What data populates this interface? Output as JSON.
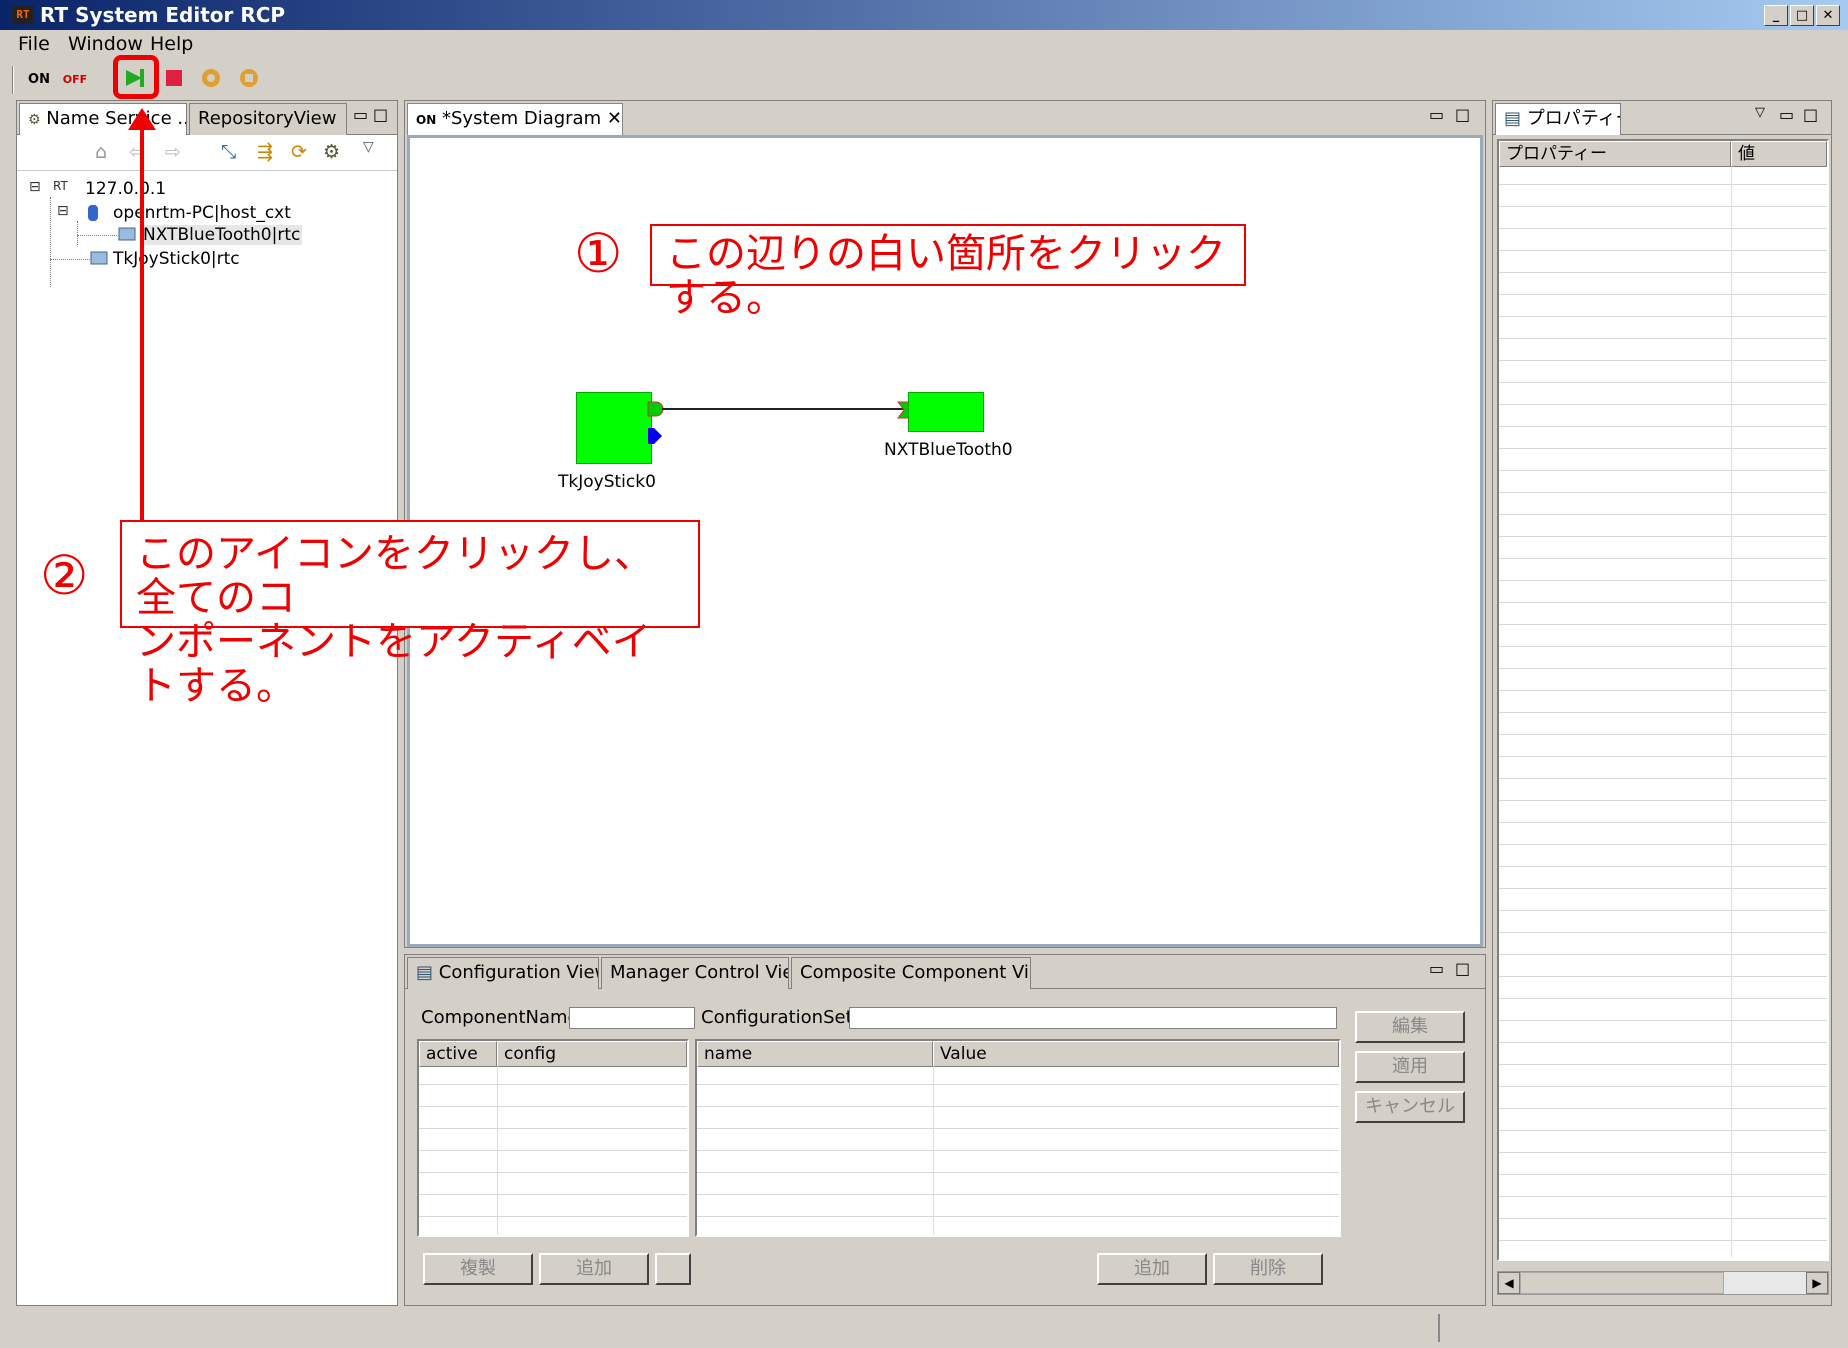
{
  "window": {
    "title": "RT System Editor RCP",
    "icon_text": "RT"
  },
  "menu": [
    "File",
    "Window",
    "Help"
  ],
  "toolbar": {
    "on_label": "ON",
    "off_label": "OFF",
    "icons": [
      "all-on-icon",
      "all-off-icon",
      "activate-all-icon",
      "deactivate-all-icon",
      "start-icon",
      "stop-icon"
    ]
  },
  "left_panel": {
    "tabs": [
      "Name Service ...",
      "RepositoryView"
    ],
    "tree": {
      "root": "127.0.0.1",
      "root_prefix": "RT",
      "host": "openrtm-PC|host_cxt",
      "children": [
        "NXTBlueTooth0|rtc",
        "TkJoyStick0|rtc"
      ]
    }
  },
  "diagram": {
    "tab_label": "*System Diagram",
    "components": [
      "TkJoyStick0",
      "NXTBlueTooth0"
    ],
    "colors": {
      "component": "#00ff00",
      "inport": "#00cc00",
      "outport_service": "#0000ee"
    }
  },
  "bottom_panel": {
    "tabs": [
      "Configuration View",
      "Manager Control View",
      "Composite Component View"
    ],
    "component_name_label": "ComponentName:",
    "configuration_set_label": "ConfigurationSet:",
    "left_table_headers": [
      "active",
      "config"
    ],
    "right_table_headers": [
      "name",
      "Value"
    ],
    "buttons": {
      "edit": "編集",
      "apply": "適用",
      "cancel": "キャンセル",
      "copy": "複製",
      "add_left": "追加",
      "add_right": "追加",
      "delete": "削除"
    }
  },
  "right_panel": {
    "tab": "プロパティー",
    "headers": [
      "プロパティー",
      "値"
    ]
  },
  "annotations": {
    "step1_number": "①",
    "step1_text": "この辺りの白い箇所をクリックする。",
    "step2_number": "②",
    "step2_line1": "このアイコンをクリックし、全てのコ",
    "step2_line2": "ンポーネントをアクティベイトする。",
    "color": "#e00000"
  }
}
